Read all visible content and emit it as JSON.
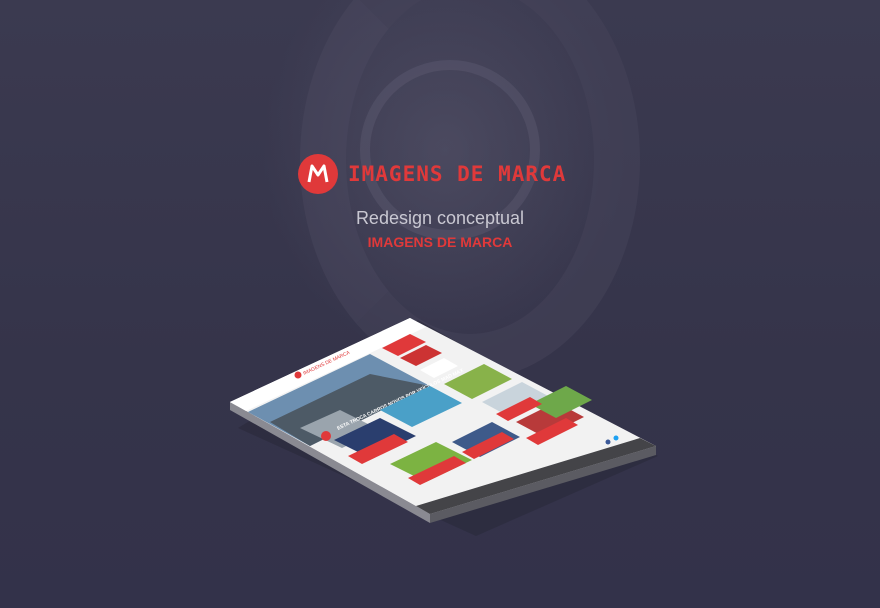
{
  "brand": {
    "name": "IMAGENS DE MARCA",
    "logo_letter": "M",
    "accent": "#e0393a"
  },
  "headline": {
    "subtitle": "Redesign conceptual",
    "tagline": "IMAGENS DE MARCA"
  },
  "mockup": {
    "site_logo_text": "IMAGENS DE MARCA",
    "hero_caption": "ESTA TROCA CARROS NOVOS POR VEÍCULOS MAD MAX"
  }
}
